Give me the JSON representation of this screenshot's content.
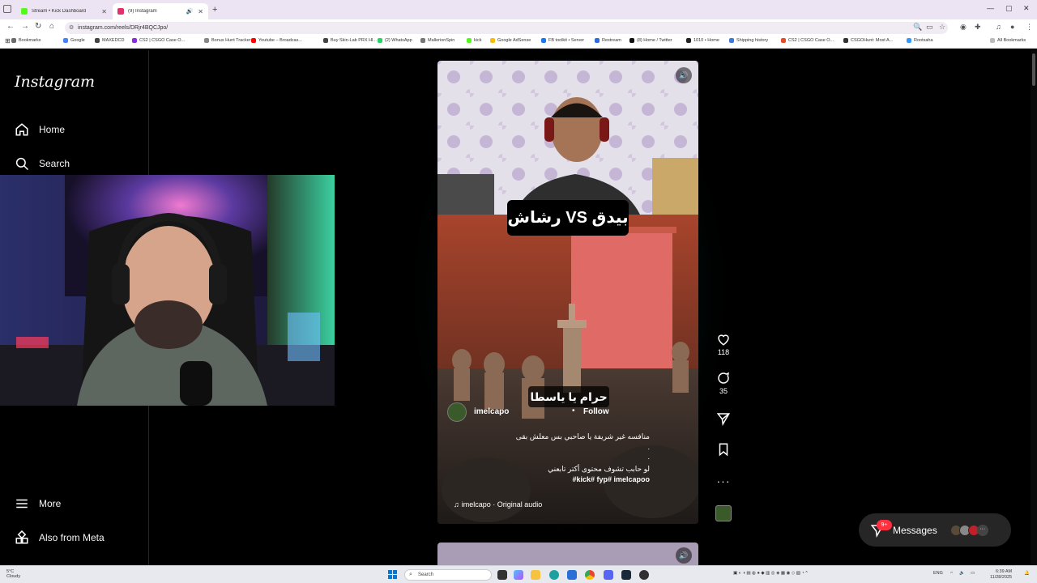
{
  "browser": {
    "tabs": [
      {
        "title": "Stream • Kick Dashboard",
        "favicon_color": "#53fc18"
      },
      {
        "title": "(9) Instagram",
        "favicon_color": "#e1306c",
        "active": true
      }
    ],
    "url": "instagram.com/reels/DRjr4BQCJpo/",
    "bookmarks": [
      {
        "label": "Bookmarks",
        "color": "#6b6b6b"
      },
      {
        "label": "Google",
        "color": "#4285f4"
      },
      {
        "label": "MAXEDCD",
        "color": "#444444"
      },
      {
        "label": "CS2 | CSGO Case O...",
        "color": "#8a2be2"
      },
      {
        "label": "Bonus Hunt Tracker",
        "color": "#888888"
      },
      {
        "label": "Youtube – Broadcas...",
        "color": "#ff0000"
      },
      {
        "label": "Buy Skin-Lab PRX Hl...",
        "color": "#444444"
      },
      {
        "label": "(2) WhatsApp",
        "color": "#25d366"
      },
      {
        "label": "MallerionSpin",
        "color": "#777777"
      },
      {
        "label": "kick",
        "color": "#53fc18"
      },
      {
        "label": "Google AdSense",
        "color": "#fbbc05"
      },
      {
        "label": "FB toolkit • Server",
        "color": "#1877f2"
      },
      {
        "label": "Restream",
        "color": "#2d6cdf"
      },
      {
        "label": "(8) Home / Twitter",
        "color": "#111111"
      },
      {
        "label": "1010 • Home",
        "color": "#222222"
      },
      {
        "label": "Shipping history",
        "color": "#3a7bd5"
      },
      {
        "label": "CS2 | CSGO Case O...",
        "color": "#e44d26"
      },
      {
        "label": "CSGOHunt: Most A...",
        "color": "#333333"
      },
      {
        "label": "Rootsaha",
        "color": "#3399ff"
      }
    ],
    "all_bookmarks_label": "All Bookmarks"
  },
  "sidebar": {
    "logo": "Instagram",
    "items": [
      {
        "label": "Home",
        "icon": "home-icon"
      },
      {
        "label": "Search",
        "icon": "search-icon"
      }
    ],
    "bottom_items": [
      {
        "label": "More",
        "icon": "hamburger-icon"
      },
      {
        "label": "Also from Meta",
        "icon": "meta-grid-icon"
      }
    ]
  },
  "reel": {
    "title_overlay": "رشاش VS بيدق",
    "subtitle_overlay": "حرام يا ياسطا",
    "username": "imelcapo",
    "follow_label": "Follow",
    "caption_line1": "منافسه غير شريفة يا صاحبي بس معلش بقى",
    "caption_line2": ".",
    "caption_line3": ".",
    "caption_line4": "لو حابب تشوف محتوى أكتر تابعني",
    "hashtags": "#kick# fyp# imelcapoo",
    "audio_label": "imelcapo · Original audio"
  },
  "actions": {
    "likes": "118",
    "comments": "35"
  },
  "messages": {
    "label": "Messages",
    "badge": "9+"
  },
  "taskbar": {
    "weather_temp": "5°C",
    "weather_desc": "Cloudy",
    "search_placeholder": "Search",
    "lang": "ENG",
    "time": "6:39 AM",
    "date": "11/28/2025"
  }
}
